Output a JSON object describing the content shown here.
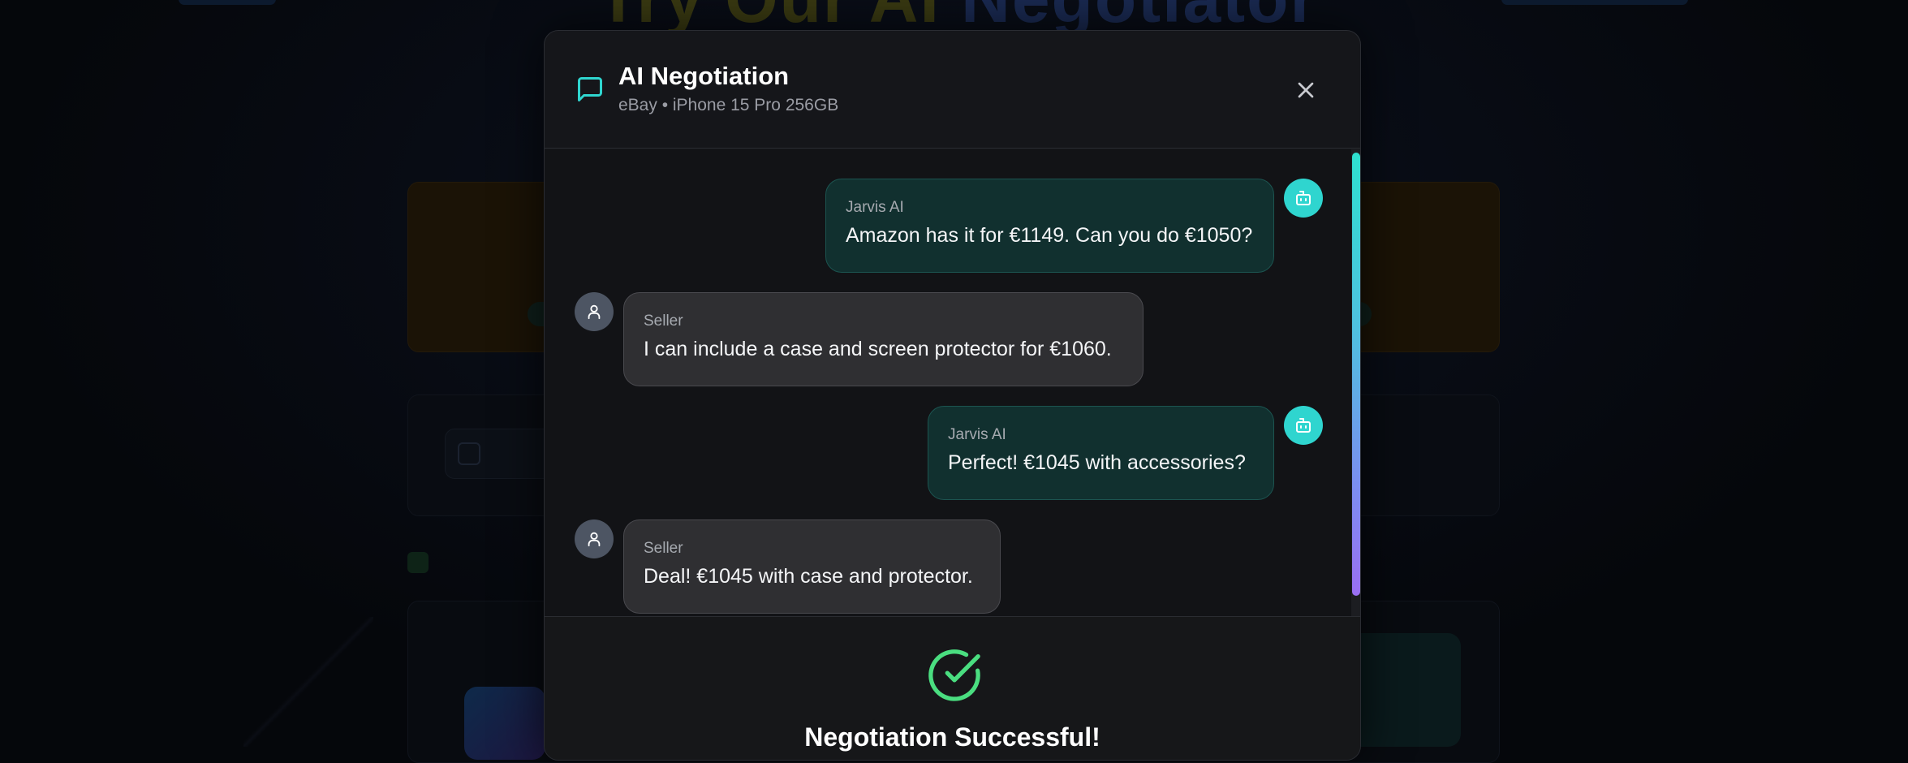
{
  "background": {
    "heading_parts": [
      "Try Our AI ",
      "Negotiator"
    ],
    "nav_items": [
      "",
      "",
      ""
    ],
    "card_label": "",
    "found_label": ""
  },
  "modal": {
    "icon": "message-square-icon",
    "title": "AI Negotiation",
    "subtitle": "eBay • iPhone 15 Pro 256GB",
    "close_icon": "close-icon",
    "messages": [
      {
        "role": "ai",
        "sender": "Jarvis AI",
        "text": "Amazon has it for €1149. Can you do €1050?"
      },
      {
        "role": "seller",
        "sender": "Seller",
        "text": "I can include a case and screen protector for €1060."
      },
      {
        "role": "ai",
        "sender": "Jarvis AI",
        "text": "Perfect! €1045 with accessories?"
      },
      {
        "role": "seller",
        "sender": "Seller",
        "text": "Deal! €1045 with case and protector."
      }
    ],
    "result": {
      "icon": "check-circle-icon",
      "text": "Negotiation Successful!"
    }
  },
  "colors": {
    "accent_teal": "#2fd5cf",
    "success_green": "#4ade80",
    "ai_bubble": "#11302f",
    "seller_bubble": "#2f2f32"
  }
}
